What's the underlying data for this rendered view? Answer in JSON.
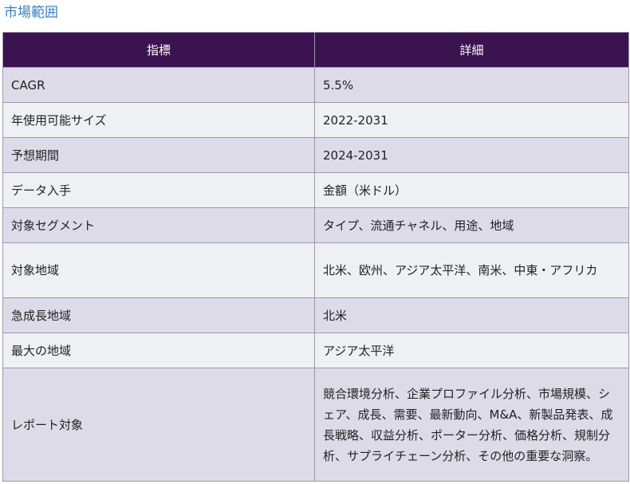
{
  "section": {
    "heading": "市場範囲"
  },
  "table": {
    "headers": {
      "metric": "指標",
      "detail": "詳細"
    },
    "rows": [
      {
        "metric": "CAGR",
        "detail": "5.5%"
      },
      {
        "metric": "年使用可能サイズ",
        "detail": "2022-2031"
      },
      {
        "metric": "予想期間",
        "detail": "2024-2031"
      },
      {
        "metric": "データ入手",
        "detail": "金額（米ドル）"
      },
      {
        "metric": "対象セグメント",
        "detail": "タイプ、流通チャネル、用途、地域"
      },
      {
        "metric": "対象地域",
        "detail": "北米、欧州、アジア太平洋、南米、中東・アフリカ"
      },
      {
        "metric": "急成長地域",
        "detail": "北米"
      },
      {
        "metric": "最大の地域",
        "detail": "アジア太平洋"
      },
      {
        "metric": "レポート対象",
        "detail": "競合環境分析、企業プロファイル分析、市場規模、シェア、成長、需要、最新動向、M&A、新製品発表、成長戦略、収益分析、ポーター分析、価格分析、規制分析、サプライチェーン分析、その他の重要な洞察。"
      }
    ]
  }
}
